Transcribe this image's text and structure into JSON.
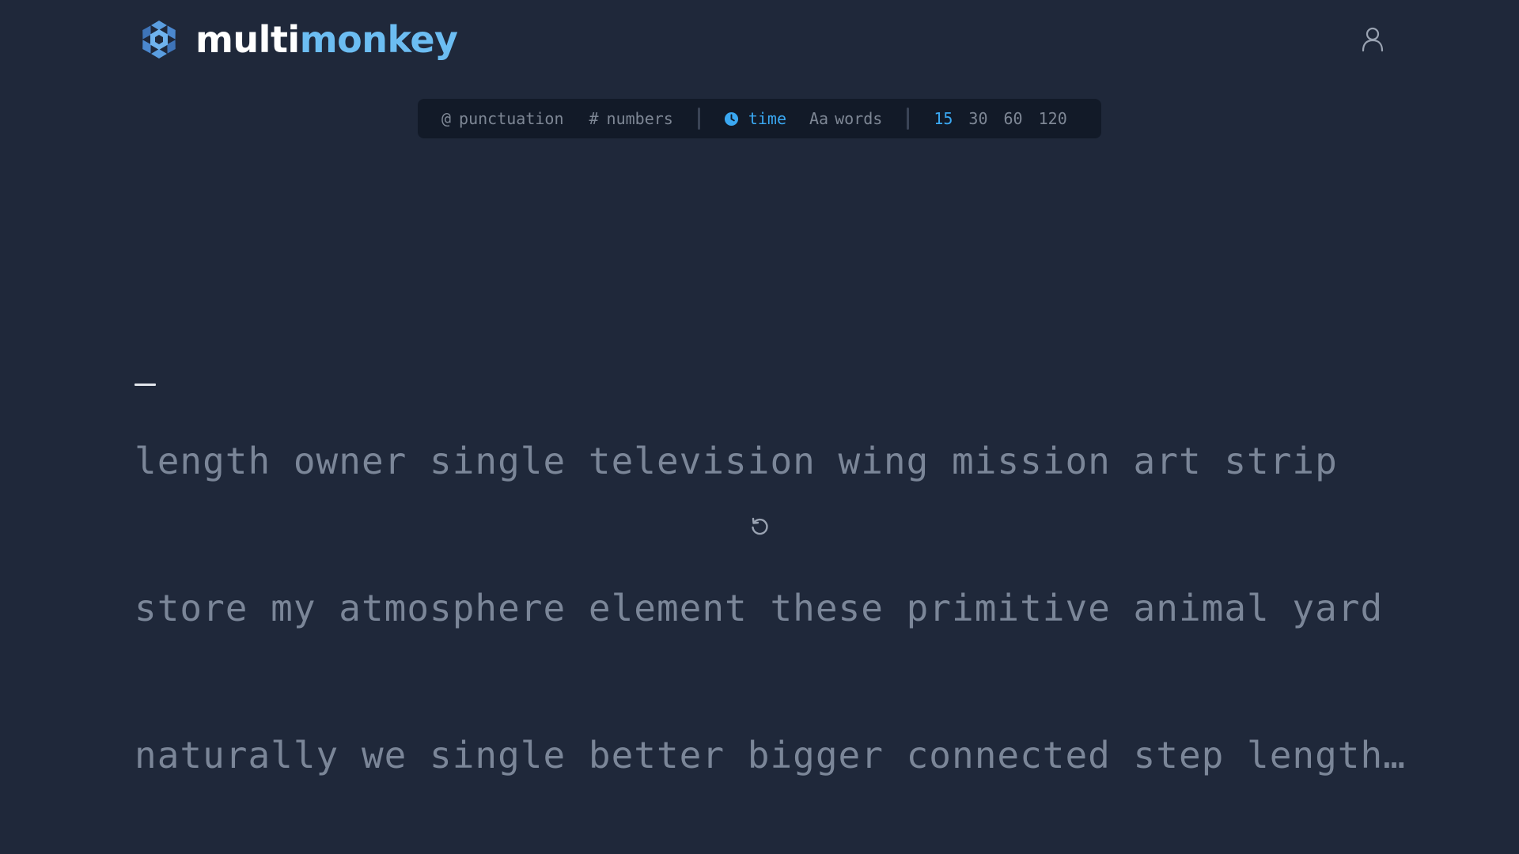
{
  "brand": {
    "part1": "multi",
    "part2": "monkey"
  },
  "icons": {
    "logo": "hexagon-logo-icon",
    "user": "user-icon",
    "punctuation": "at-sign-icon",
    "numbers": "hash-icon",
    "time": "clock-icon",
    "words": "text-size-icon",
    "restart": "restart-icon"
  },
  "config": {
    "punctuation_label": "punctuation",
    "numbers_label": "numbers",
    "time_label": "time",
    "words_icon_text": "Aa",
    "words_label": "words",
    "durations": [
      "15",
      "30",
      "60",
      "120"
    ],
    "active_duration": "15"
  },
  "test": {
    "lines": [
      "length owner single television wing mission art strip",
      "store my atmosphere element these primitive animal yard",
      "naturally we single better bigger connected step length…"
    ]
  },
  "colors": {
    "background": "#1f283a",
    "bar_background": "#121a28",
    "accent": "#3aa8f2",
    "brand_accent": "#6cbdf2",
    "text_muted": "#7b8698"
  }
}
